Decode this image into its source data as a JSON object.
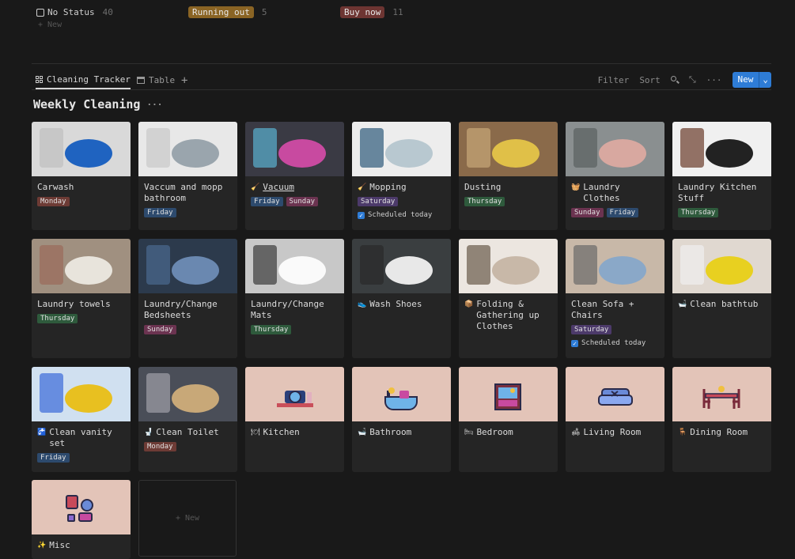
{
  "status_groups": [
    {
      "label": "No Status",
      "count": "40",
      "color": "#191919"
    },
    {
      "label": "Running out",
      "count": "5",
      "color": "#8a6424"
    },
    {
      "label": "Buy now",
      "count": "11",
      "color": "#6d3532"
    }
  ],
  "add_new_label": "+ New",
  "tabs": [
    {
      "label": "Cleaning Tracker",
      "icon": "gallery-icon"
    },
    {
      "label": "Table",
      "icon": "table-icon"
    }
  ],
  "toolbar": {
    "filter": "Filter",
    "sort": "Sort",
    "new": "New"
  },
  "section_title": "Weekly Cleaning",
  "cards": [
    {
      "title": "Carwash",
      "icon": "",
      "tags": [
        "Monday"
      ],
      "scheduled": false
    },
    {
      "title": "Vaccum and mopp bathroom",
      "icon": "",
      "tags": [
        "Friday"
      ],
      "scheduled": false
    },
    {
      "title": "Vacuum",
      "icon": "broom-icon",
      "tags": [
        "Friday",
        "Sunday"
      ],
      "scheduled": false
    },
    {
      "title": "Mopping",
      "icon": "mop-icon",
      "tags": [
        "Saturday"
      ],
      "scheduled": true
    },
    {
      "title": "Dusting",
      "icon": "",
      "tags": [
        "Thursday"
      ],
      "scheduled": false
    },
    {
      "title": "Laundry Clothes",
      "icon": "basket-icon",
      "tags": [
        "Sunday",
        "Friday"
      ],
      "scheduled": false
    },
    {
      "title": "Laundry Kitchen Stuff",
      "icon": "",
      "tags": [
        "Thursday"
      ],
      "scheduled": false
    },
    {
      "title": "Laundry towels",
      "icon": "",
      "tags": [
        "Thursday"
      ],
      "scheduled": false
    },
    {
      "title": "Laundry/Change Bedsheets",
      "icon": "",
      "tags": [
        "Sunday"
      ],
      "scheduled": false
    },
    {
      "title": "Laundry/Change Mats",
      "icon": "",
      "tags": [
        "Thursday"
      ],
      "scheduled": false
    },
    {
      "title": "Wash Shoes",
      "icon": "shoe-icon",
      "tags": [],
      "scheduled": false
    },
    {
      "title": "Folding & Gathering up Clothes",
      "icon": "box-icon",
      "tags": [],
      "scheduled": false
    },
    {
      "title": "Clean Sofa + Chairs",
      "icon": "",
      "tags": [
        "Saturday"
      ],
      "scheduled": true
    },
    {
      "title": "Clean bathtub",
      "icon": "bathtub-icon",
      "tags": [],
      "scheduled": false
    },
    {
      "title": "Clean vanity set",
      "icon": "sink-icon",
      "tags": [
        "Friday"
      ],
      "scheduled": false
    },
    {
      "title": "Clean Toilet",
      "icon": "toilet-icon",
      "tags": [
        "Monday"
      ],
      "scheduled": false
    },
    {
      "title": "Kitchen",
      "icon": "kitchen-icon",
      "tags": [],
      "scheduled": false
    },
    {
      "title": "Bathroom",
      "icon": "bathroom-icon",
      "tags": [],
      "scheduled": false
    },
    {
      "title": "Bedroom",
      "icon": "bedroom-icon",
      "tags": [],
      "scheduled": false
    },
    {
      "title": "Living Room",
      "icon": "sofa-icon",
      "tags": [],
      "scheduled": false
    },
    {
      "title": "Dining Room",
      "icon": "dining-icon",
      "tags": [],
      "scheduled": false
    },
    {
      "title": "Misc",
      "icon": "misc-icon",
      "tags": [],
      "scheduled": false
    }
  ],
  "scheduled_label": "Scheduled today",
  "new_card_label": "+ New"
}
